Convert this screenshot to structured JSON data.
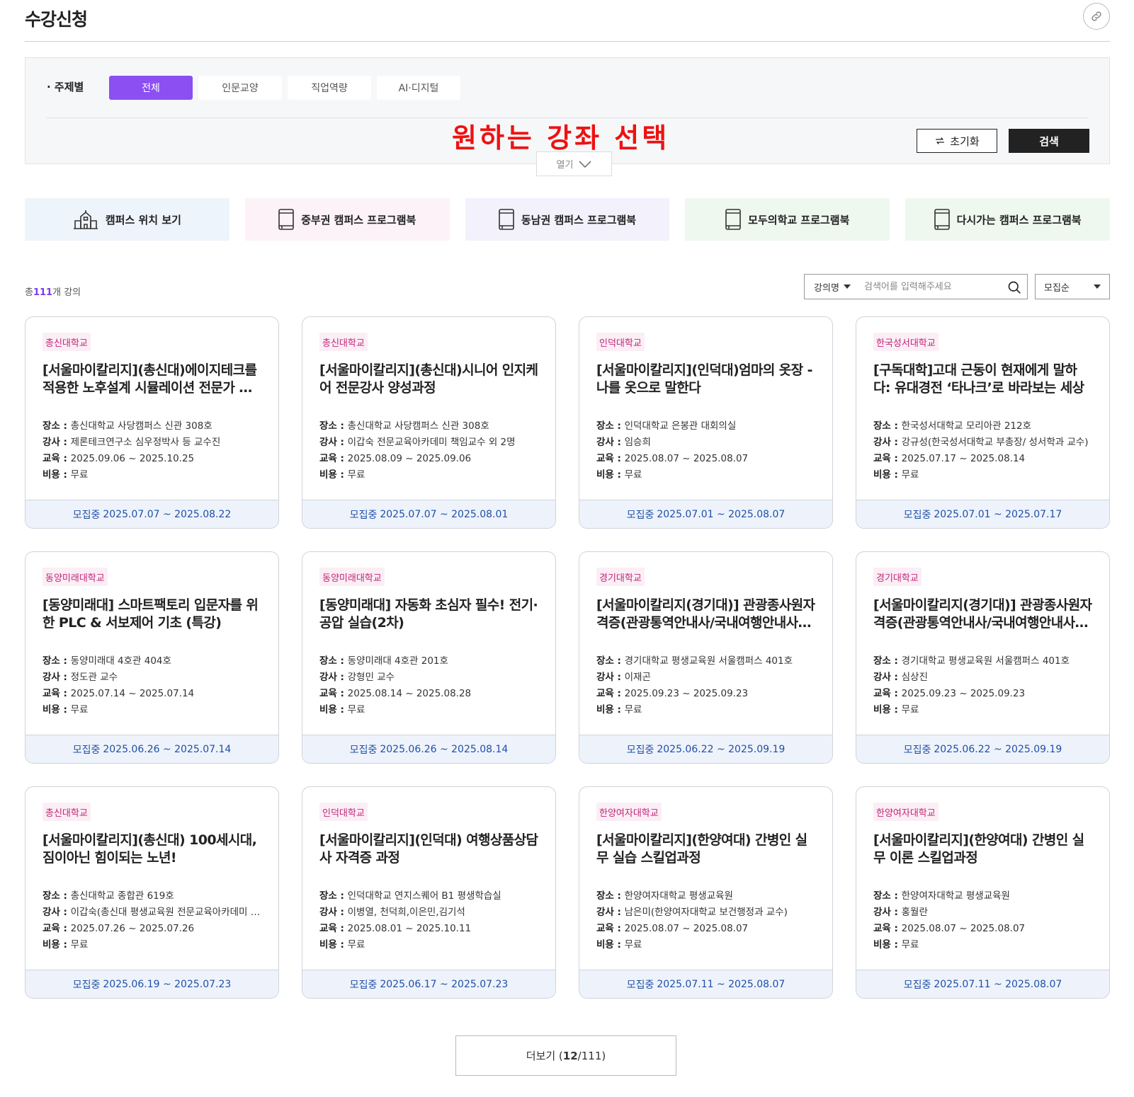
{
  "header": {
    "title": "수강신청",
    "link_icon": "link-icon"
  },
  "filter": {
    "label": "· 주제별",
    "tabs": [
      {
        "label": "전체",
        "active": true
      },
      {
        "label": "인문교양",
        "active": false
      },
      {
        "label": "직업역량",
        "active": false
      },
      {
        "label": "AI·디지털",
        "active": false
      }
    ],
    "overlay_text": "원하는 강좌 선택",
    "reset_label": "초기화",
    "search_label": "검색",
    "open_label": "열기",
    "accent_color": "#8b4ff2"
  },
  "quick_links": [
    {
      "label": "캠퍼스 위치 보기",
      "icon": "campus-building-icon",
      "bg": "#eef4fb"
    },
    {
      "label": "중부권 캠퍼스 프로그램북",
      "icon": "book-icon",
      "bg": "#fdf2f7"
    },
    {
      "label": "동남권 캠퍼스 프로그램북",
      "icon": "book-icon",
      "bg": "#f3f1fc"
    },
    {
      "label": "모두의학교 프로그램북",
      "icon": "book-icon",
      "bg": "#eef8ef"
    },
    {
      "label": "다시가는 캠퍼스 프로그램북",
      "icon": "book-icon",
      "bg": "#eef8ef"
    }
  ],
  "list": {
    "total_prefix": "총",
    "total_count": "111",
    "total_suffix": "개 강의",
    "search_field": "강의명",
    "search_placeholder": "검색어를 입력해주세요",
    "sort": "모집순"
  },
  "labels": {
    "place": "장소 : ",
    "teacher": "강사 : ",
    "period": "교육 : ",
    "cost": "비용 : "
  },
  "courses": [
    {
      "school": "총신대학교",
      "title": "[서울마이칼리지](총신대)에이지테크를 적용한 노후설계 시뮬레이션 전문가 양성과정",
      "place": "총신대학교 사당캠퍼스 신관 308호",
      "teacher": "제론테크연구소 심우정박사 등 교수진",
      "period": "2025.09.06 ~ 2025.10.25",
      "cost": "무료",
      "status": "모집중",
      "recruit": "2025.07.07 ~ 2025.08.22"
    },
    {
      "school": "총신대학교",
      "title": "[서울마이칼리지](총신대)시니어 인지케어 전문강사 양성과정",
      "place": "총신대학교 사당캠퍼스 신관 308호",
      "teacher": "이갑숙 전문교육아카데미 책임교수 외 2명",
      "period": "2025.08.09 ~ 2025.09.06",
      "cost": "무료",
      "status": "모집중",
      "recruit": "2025.07.07 ~ 2025.08.01"
    },
    {
      "school": "인덕대학교",
      "title": "[서울마이칼리지](인덕대)엄마의 옷장 - 나를 옷으로 말한다",
      "place": "인덕대학교 은봉관 대회의실",
      "teacher": "임승희",
      "period": "2025.08.07 ~ 2025.08.07",
      "cost": "무료",
      "status": "모집중",
      "recruit": "2025.07.01 ~ 2025.08.07"
    },
    {
      "school": "한국성서대학교",
      "title": "[구독대학]고대 근동이 현재에게 말하다: 유대경전 ‘타나크’로 바라보는 세상",
      "place": "한국성서대학교 모리아관 212호",
      "teacher": "강규성(한국성서대학교 부총장/ 성서학과 교수)",
      "period": "2025.07.17 ~ 2025.08.14",
      "cost": "무료",
      "status": "모집중",
      "recruit": "2025.07.01 ~ 2025.07.17"
    },
    {
      "school": "동양미래대학교",
      "title": "[동양미래대] 스마트팩토리 입문자를 위한 PLC & 서보제어 기초 (특강)",
      "place": "동양미래대 4호관 404호",
      "teacher": "정도관 교수",
      "period": "2025.07.14 ~ 2025.07.14",
      "cost": "무료",
      "status": "모집중",
      "recruit": "2025.06.26 ~ 2025.07.14"
    },
    {
      "school": "동양미래대학교",
      "title": "[동양미래대] 자동화 초심자 필수! 전기·공압 실습(2차)",
      "place": "동양미래대 4호관 201호",
      "teacher": "강형민 교수",
      "period": "2025.08.14 ~ 2025.08.28",
      "cost": "무료",
      "status": "모집중",
      "recruit": "2025.06.26 ~ 2025.08.14"
    },
    {
      "school": "경기대학교",
      "title": "[서울마이칼리지(경기대)] 관광종사원자격증(관광통역안내사/국내여행안내사) 과정",
      "place": "경기대학교 평생교육원 서울캠퍼스 401호",
      "teacher": "이재곤",
      "period": "2025.09.23 ~ 2025.09.23",
      "cost": "무료",
      "status": "모집중",
      "recruit": "2025.06.22 ~ 2025.09.19"
    },
    {
      "school": "경기대학교",
      "title": "[서울마이칼리지(경기대)] 관광종사원자격증(관광통역안내사/국내여행안내사) 과정",
      "place": "경기대학교 평생교육원 서울캠퍼스 401호",
      "teacher": "심상진",
      "period": "2025.09.23 ~ 2025.09.23",
      "cost": "무료",
      "status": "모집중",
      "recruit": "2025.06.22 ~ 2025.09.19"
    },
    {
      "school": "총신대학교",
      "title": "[서울마이칼리지](총신대) 100세시대, 짐이아닌 힘이되는 노년!",
      "place": "총신대학교 종합관 619호",
      "teacher": "이갑숙(총신대 평생교육원 전문교육아카데미 책임교수)",
      "period": "2025.07.26 ~ 2025.07.26",
      "cost": "무료",
      "status": "모집중",
      "recruit": "2025.06.19 ~ 2025.07.23"
    },
    {
      "school": "인덕대학교",
      "title": "[서울마이칼리지](인덕대) 여행상품상담사 자격증 과정",
      "place": "인덕대학교 연지스퀘어 B1 평생학습실",
      "teacher": "이병열, 천덕희,이은민,김기석",
      "period": "2025.08.01 ~ 2025.10.11",
      "cost": "무료",
      "status": "모집중",
      "recruit": "2025.06.17 ~ 2025.07.23"
    },
    {
      "school": "한양여자대학교",
      "title": "[서울마이칼리지](한양여대) 간병인 실무 실습 스킬업과정",
      "place": "한양여자대학교 평생교육원",
      "teacher": "남은미(한양여자대학교 보건행정과 교수)",
      "period": "2025.08.07 ~ 2025.08.07",
      "cost": "무료",
      "status": "모집중",
      "recruit": "2025.07.11 ~ 2025.08.07"
    },
    {
      "school": "한양여자대학교",
      "title": "[서울마이칼리지](한양여대) 간병인 실무 이론 스킬업과정",
      "place": "한양여자대학교 평생교육원",
      "teacher": "홍월란",
      "period": "2025.08.07 ~ 2025.08.07",
      "cost": "무료",
      "status": "모집중",
      "recruit": "2025.07.11 ~ 2025.08.07"
    }
  ],
  "more": {
    "label": "더보기 (",
    "shown": "12",
    "sep": "/",
    "total": "111",
    "close": ")"
  }
}
